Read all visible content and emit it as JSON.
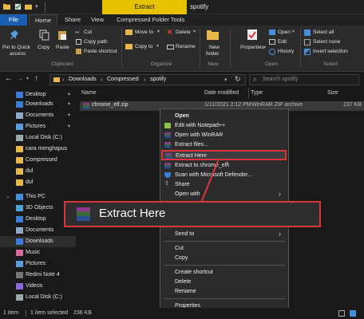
{
  "window": {
    "context_tab": "Extract",
    "title": "spotify"
  },
  "ribbon_tabs": {
    "file": "File",
    "home": "Home",
    "share": "Share",
    "view": "View",
    "compressed_tools": "Compressed Folder Tools"
  },
  "ribbon": {
    "pin_to_quick_access": "Pin to Quick",
    "pin_to_quick_access_2": "access",
    "copy": "Copy",
    "paste": "Paste",
    "cut": "Cut",
    "copy_path": "Copy path",
    "paste_shortcut": "Paste shortcut",
    "move_to": "Move to",
    "copy_to": "Copy to",
    "delete": "Delete",
    "rename": "Rename",
    "new_folder": "New",
    "new_folder_2": "folder",
    "properties": "Properties",
    "open": "Open",
    "edit": "Edit",
    "history": "History",
    "select_all": "Select all",
    "select_none": "Select none",
    "invert_selection": "Invert selection",
    "groups": {
      "clipboard": "Clipboard",
      "organize": "Organize",
      "new": "New",
      "open": "Open",
      "select": "Select"
    }
  },
  "address": {
    "crumbs": [
      "Downloads",
      "Compressed",
      "spotify"
    ],
    "search_placeholder": "Search spotify"
  },
  "nav": {
    "items": [
      {
        "label": "Desktop",
        "icon": "desktop-icon"
      },
      {
        "label": "Downloads",
        "icon": "download-icon"
      },
      {
        "label": "Documents",
        "icon": "documents-icon"
      },
      {
        "label": "Pictures",
        "icon": "pictures-icon"
      },
      {
        "label": "Local Disk (C:)",
        "icon": "drive-icon"
      },
      {
        "label": "cara menghapus",
        "icon": "folder-icon"
      },
      {
        "label": "Compressed",
        "icon": "folder-icon"
      },
      {
        "label": "dul",
        "icon": "folder-icon"
      },
      {
        "label": "dul",
        "icon": "folder-icon"
      },
      {
        "label": "This PC",
        "icon": "pc-icon"
      },
      {
        "label": "3D Objects",
        "icon": "3d-objects-icon"
      },
      {
        "label": "Desktop",
        "icon": "desktop-icon"
      },
      {
        "label": "Documents",
        "icon": "documents-icon"
      },
      {
        "label": "Downloads",
        "icon": "download-icon"
      },
      {
        "label": "Music",
        "icon": "music-icon"
      },
      {
        "label": "Pictures",
        "icon": "pictures-icon"
      },
      {
        "label": "Redmi Note 4",
        "icon": "phone-icon"
      },
      {
        "label": "Videos",
        "icon": "videos-icon"
      },
      {
        "label": "Local Disk (C:)",
        "icon": "drive-icon"
      }
    ]
  },
  "columns": {
    "name": "Name",
    "date": "Date modified",
    "type": "Type",
    "size": "Size"
  },
  "file": {
    "name": "chrome_elf.zip",
    "date": "1/11/2021 2:12 PM",
    "type": "WinRAR ZIP archive",
    "size": "237 KB"
  },
  "context_menu": {
    "open": "Open",
    "edit_notepad": "Edit with Notepad++",
    "open_winrar": "Open with WinRAR",
    "extract_files": "Extract files...",
    "extract_here": "Extract Here",
    "extract_to": "Extract to chrome_elf\\",
    "scan_defender": "Scan with Microsoft Defender...",
    "share": "Share",
    "open_with": "Open with",
    "send_to": "Send to",
    "cut": "Cut",
    "copy": "Copy",
    "create_shortcut": "Create shortcut",
    "delete": "Delete",
    "rename": "Rename",
    "properties": "Properties"
  },
  "zoom_callout": {
    "label": "Extract Here"
  },
  "status": {
    "count": "1 item",
    "selected": "1 item selected",
    "size": "236 KB"
  },
  "colors": {
    "highlight_red": "#d9363e",
    "file_tab_blue": "#1a5fb4",
    "extract_tab_yellow": "#e6c200",
    "folder_yellow": "#e8b84a"
  }
}
